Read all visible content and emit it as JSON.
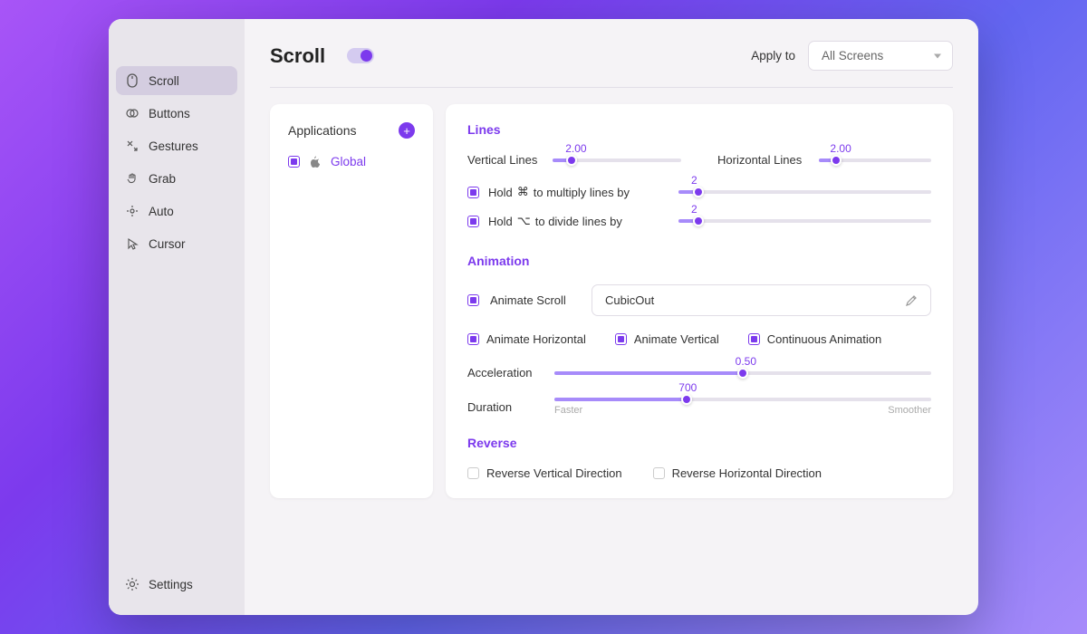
{
  "sidebar": {
    "items": [
      {
        "label": "Scroll",
        "icon": "mouse-icon"
      },
      {
        "label": "Buttons",
        "icon": "circles-icon"
      },
      {
        "label": "Gestures",
        "icon": "gesture-icon"
      },
      {
        "label": "Grab",
        "icon": "hand-icon"
      },
      {
        "label": "Auto",
        "icon": "auto-icon"
      },
      {
        "label": "Cursor",
        "icon": "cursor-icon"
      }
    ],
    "settings_label": "Settings"
  },
  "header": {
    "title": "Scroll",
    "apply_label": "Apply to",
    "apply_value": "All Screens"
  },
  "apps": {
    "title": "Applications",
    "items": [
      {
        "name": "Global"
      }
    ]
  },
  "lines": {
    "title": "Lines",
    "vertical_label": "Vertical Lines",
    "vertical_value": "2.00",
    "horizontal_label": "Horizontal Lines",
    "horizontal_value": "2.00",
    "multiply_prefix": "Hold",
    "multiply_key": "⌘",
    "multiply_suffix": "to multiply lines by",
    "multiply_value": "2",
    "divide_prefix": "Hold",
    "divide_key": "⌥",
    "divide_suffix": "to divide lines by",
    "divide_value": "2"
  },
  "animation": {
    "title": "Animation",
    "animate_label": "Animate Scroll",
    "easing": "CubicOut",
    "horizontal_label": "Animate Horizontal",
    "vertical_label": "Animate Vertical",
    "continuous_label": "Continuous Animation",
    "accel_label": "Acceleration",
    "accel_value": "0.50",
    "duration_label": "Duration",
    "duration_value": "700",
    "faster_hint": "Faster",
    "smoother_hint": "Smoother"
  },
  "reverse": {
    "title": "Reverse",
    "vertical_label": "Reverse Vertical Direction",
    "horizontal_label": "Reverse Horizontal Direction"
  }
}
